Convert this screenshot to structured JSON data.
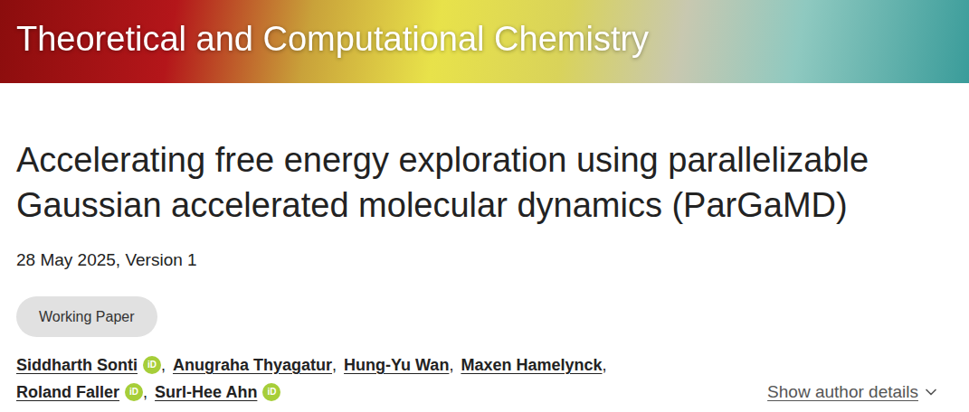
{
  "header": {
    "title": "Theoretical and Computational Chemistry"
  },
  "paper": {
    "title": "Accelerating free energy exploration using parallelizable Gaussian accelerated molecular dynamics (ParGaMD)",
    "date_version": "28 May 2025, Version 1",
    "badge": "Working Paper"
  },
  "authors": {
    "separator": ",",
    "orcid_mark": "iD",
    "items": [
      {
        "name": "Siddharth Sonti",
        "orcid": true
      },
      {
        "name": "Anugraha Thyagatur",
        "orcid": false
      },
      {
        "name": "Hung-Yu Wan",
        "orcid": false
      },
      {
        "name": "Maxen Hamelynck",
        "orcid": false
      },
      {
        "name": "Roland Faller",
        "orcid": true
      },
      {
        "name": "Surl-Hee Ahn",
        "orcid": true
      }
    ]
  },
  "show_details": {
    "label": "Show author details"
  }
}
